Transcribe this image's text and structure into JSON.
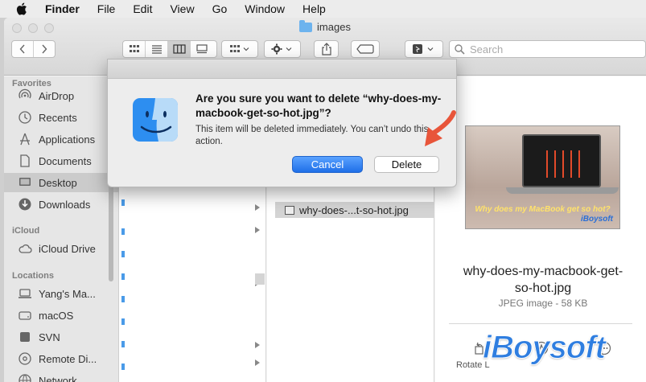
{
  "menubar": {
    "app": "Finder",
    "items": [
      "File",
      "Edit",
      "View",
      "Go",
      "Window",
      "Help"
    ]
  },
  "window": {
    "title": "images",
    "search_placeholder": "Search"
  },
  "sidebar": {
    "favorites_header": "Favorites",
    "favorites": [
      "AirDrop",
      "Recents",
      "Applications",
      "Documents",
      "Desktop",
      "Downloads"
    ],
    "icloud_header": "iCloud",
    "icloud": [
      "iCloud Drive"
    ],
    "locations_header": "Locations",
    "locations": [
      "Yang's Ma...",
      "macOS",
      "SVN",
      "Remote Di...",
      "Network"
    ]
  },
  "column": {
    "selected_file": "why-does-...t-so-hot.jpg"
  },
  "preview": {
    "file_name": "why-does-my-macbook-get-so-hot.jpg",
    "kind": "JPEG image - 58 KB",
    "thumb_caption": "Why does my MacBook get so hot?",
    "thumb_logo": "iBoysoft",
    "action_label": "Rotate L"
  },
  "dialog": {
    "title": "Are you sure you want to delete “why-does-my-macbook-get-so-hot.jpg”?",
    "message": "This item will be deleted immediately. You can’t undo this action.",
    "cancel_label": "Cancel",
    "delete_label": "Delete"
  },
  "watermark": "iBoysoft",
  "colors": {
    "accent": "#1f6fe8",
    "arrow": "#e8553a"
  }
}
